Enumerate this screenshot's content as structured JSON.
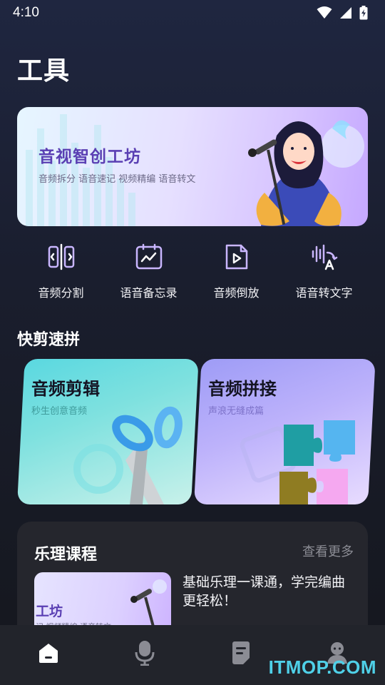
{
  "status_bar": {
    "time": "4:10",
    "icons": [
      "wifi-icon",
      "signal-icon",
      "battery-charging-icon"
    ]
  },
  "page": {
    "title": "工具"
  },
  "banner": {
    "title": "音视智创工坊",
    "subtitle": "音频拆分 语音速记 视频精编 语音转文",
    "art": "singer-illustration"
  },
  "tools": [
    {
      "label": "音频分割",
      "icon": "audio-split-icon"
    },
    {
      "label": "语音备忘录",
      "icon": "voice-memo-icon"
    },
    {
      "label": "音频倒放",
      "icon": "audio-reverse-icon"
    },
    {
      "label": "语音转文字",
      "icon": "speech-to-text-icon"
    }
  ],
  "quick_edit": {
    "section_title": "快剪速拼",
    "cards": [
      {
        "title": "音频剪辑",
        "subtitle": "秒生创意音频",
        "icon": "scissors-icon"
      },
      {
        "title": "音频拼接",
        "subtitle": "声浪无缝成篇",
        "icon": "puzzle-icon"
      }
    ]
  },
  "course": {
    "title": "乐理课程",
    "more_label": "查看更多",
    "item": {
      "thumb_title": "工坊",
      "thumb_subtitle": "记 视频精编 语音转文",
      "description": "基础乐理一课通，学完编曲更轻松！"
    }
  },
  "bottom_nav": [
    {
      "name": "home",
      "icon": "home-icon",
      "active": true
    },
    {
      "name": "record",
      "icon": "microphone-icon",
      "active": false
    },
    {
      "name": "files",
      "icon": "document-icon",
      "active": false
    },
    {
      "name": "profile",
      "icon": "user-icon",
      "active": false
    }
  ],
  "watermark": "ITMOP.COM",
  "colors": {
    "background": "#1a1e2e",
    "accent_purple": "#5a3fb3",
    "card_teal": "#5ad8e0",
    "card_violet": "#9e9cf6",
    "panel": "#25262d",
    "watermark": "#4fd0e8"
  }
}
